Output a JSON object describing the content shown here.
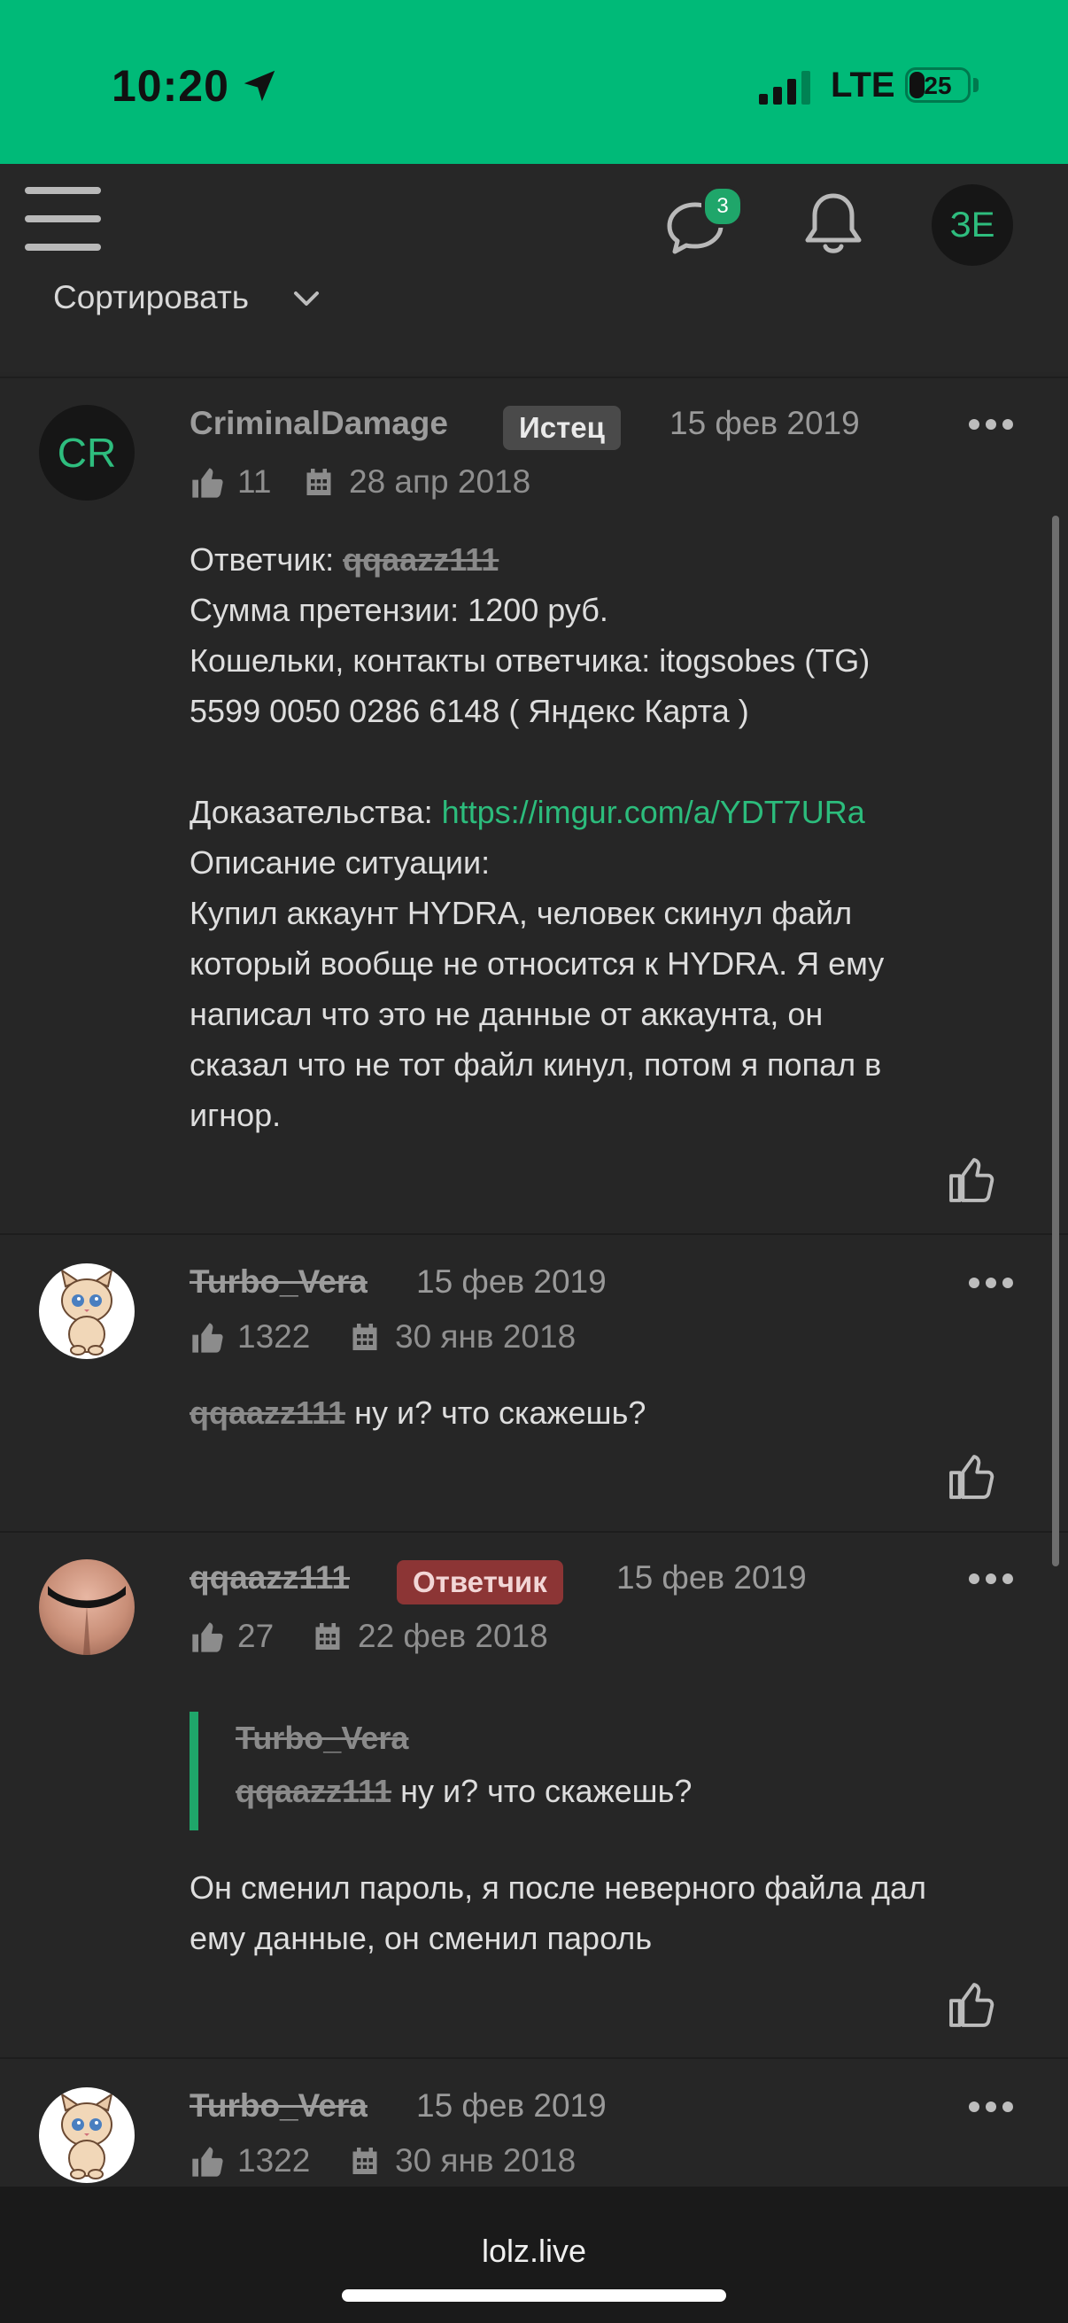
{
  "status_bar": {
    "time": "10:20",
    "network": "LTE",
    "battery": "25"
  },
  "nav": {
    "chat_badge": "3",
    "user_initials": "ЗЕ",
    "sort_label": "Сортировать"
  },
  "posts": [
    {
      "author": "CriminalDamage",
      "initials": "CR",
      "tag": "Истец",
      "date": "15 фев 2019",
      "likes": "11",
      "joined": "28 апр 2018",
      "body": {
        "defendant_label": "Ответчик:",
        "defendant_name": "qqaazz111",
        "claim": "Сумма претензии: 1200 руб.",
        "contacts": "Кошельки, контакты ответчика: itogsobes (TG)",
        "card": "5599 0050 0286 6148 ( Яндекс Карта )",
        "evidence_label": "Доказательства:",
        "evidence_link": "https://imgur.com/a/YDT7URa",
        "description_label": "Описание ситуации:",
        "description_lines": [
          "Купил аккаунт HYDRA, человек скинул файл",
          "который вообще не относится к HYDRA. Я ему",
          "написал что это не данные от аккаунта, он",
          "сказал что не тот файл кинул, потом я попал в",
          "игнор."
        ]
      }
    },
    {
      "author": "Turbo_Vera",
      "date": "15 фев 2019",
      "likes": "1322",
      "joined": "30 янв 2018",
      "mention": "qqaazz111",
      "text": "ну и? что скажешь?"
    },
    {
      "author": "qqaazz111",
      "tag": "Ответчик",
      "date": "15 фев 2019",
      "likes": "27",
      "joined": "22 фев 2018",
      "quote": {
        "author": "Turbo_Vera",
        "mention": "qqaazz111",
        "text": "ну и? что скажешь?"
      },
      "text_lines": [
        "Он сменил пароль, я после неверного файла дал",
        "ему данные, он сменил пароль"
      ]
    },
    {
      "author": "Turbo_Vera",
      "date": "15 фев 2019",
      "likes": "1322",
      "joined": "30 янв 2018"
    }
  ],
  "url_bar": {
    "url": "lolz.live"
  },
  "colors": {
    "accent": "#00ba78",
    "link": "#2cbc7c",
    "defendant_tag": "#8c3535",
    "plaintiff_tag": "#4a4a4a"
  }
}
